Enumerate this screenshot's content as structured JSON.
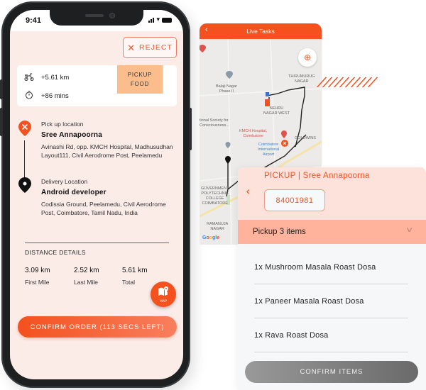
{
  "phone": {
    "status_bar": {
      "time": "9:41"
    },
    "reject_label": "REJECT",
    "info": {
      "distance": "+5.61 km",
      "duration": "+86 mins",
      "badge_line1": "PICKUP",
      "badge_line2": "FOOD"
    },
    "pickup": {
      "label": "Pick up location",
      "name": "Sree Annapoorna",
      "address": "Avinashi Rd, opp. KMCH Hospital, Madhusudhan Layout111, Civil Aerodrome Post, Peelamedu"
    },
    "delivery": {
      "label": "Delivery Location",
      "name": "Android developer",
      "address": "Codissia Ground, Peelamedu, Civil Aerodrome Post, Coimbatore, Tamil Nadu, India"
    },
    "distance_details": {
      "title": "DISTANCE DETAILS",
      "items": [
        {
          "value": "3.09 km",
          "label": "First Mile"
        },
        {
          "value": "2.52 km",
          "label": "Last Mile"
        },
        {
          "value": "5.61 km",
          "label": "Total"
        }
      ]
    },
    "map_fab_label": "MAP",
    "confirm_order_label": "CONFIRM ORDER (113 SECS LEFT)"
  },
  "map_card": {
    "title": "Live Tasks",
    "labels": {
      "thirumurugan": "THIRUMURUG\nNAGAR",
      "balaji": "Balaji Nagar\nPhase II",
      "nehru": "NEHRU\nNAGAR WEST",
      "society": "tional Society for\nConsciousness...",
      "goldwins": "GOLDWINS",
      "kmch": "KMCH Hospital,\nCoimbatore",
      "airport": "Coimbatore\nInternational\nAirport",
      "govt": "GOVERNMENT\nPOLYTECHNIC\nCOLLEGE\nCOIMBATORE",
      "ramanuja": "RAMANUJA\nNAGAR",
      "google": "Google"
    }
  },
  "pickup_panel": {
    "title": "PICKUP | Sree Annapoorna",
    "order_id": "84001981",
    "items_header": "Pickup 3 items",
    "items": [
      "1x Mushroom Masala Roast Dosa",
      "1x Paneer Masala Roast Dosa",
      "1x Rava Roast Dosa"
    ],
    "confirm_label": "CONFIRM ITEMS"
  },
  "colors": {
    "accent": "#f4511e",
    "screen_bg": "#fbece8",
    "badge_bg": "#fbbd8c",
    "items_bar": "#ffb39c"
  }
}
